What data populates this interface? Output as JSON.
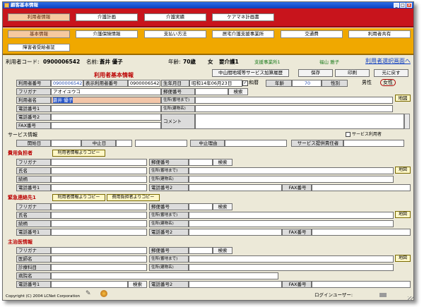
{
  "window": {
    "title": "顧客基本情報"
  },
  "tabs_row1": [
    "利用者情報",
    "介護計画",
    "介護実績",
    "ケアマネ計画書"
  ],
  "tabs_row2": [
    "基本情報",
    "介護保険情報",
    "支払い方法",
    "居宅介護支援事業所",
    "交通費",
    "利用者共有",
    "障害者受給者証"
  ],
  "header": {
    "user_code_label": "利用者コード:",
    "user_code": "0900006542",
    "name_label": "名前:",
    "name": "蒼井 優子",
    "age_label": "年齢:",
    "age": "70歳",
    "gender": "女",
    "care_level": "要介護1",
    "office": "支援事業所1",
    "staff": "福山 雅子",
    "switch_link": "利用者選択画面へ"
  },
  "basic": {
    "heading": "利用者基本情報",
    "btn_history": "中山間地域等サービス加算履歴",
    "btn_save": "保存",
    "btn_print": "印刷",
    "btn_back": "元に戻す",
    "lbl_user_no": "利用者番号",
    "user_no": "0900006542",
    "lbl_display_no": "表示利用者番号",
    "display_no": "0900006542",
    "lbl_birth": "生年月日",
    "birth": "昭和14年06月23日",
    "era_check": "和暦",
    "lbl_age": "年齢",
    "age_val": "70",
    "lbl_gender": "性別",
    "gender_male": "男性",
    "gender_female": "女性",
    "lbl_furigana": "フリガナ",
    "furigana": "アオイユウコ",
    "lbl_name": "利用者名",
    "name": "蒼井 優子",
    "lbl_tel1": "電話番号1",
    "lbl_tel2": "電話番号2",
    "lbl_fax": "FAX番号",
    "lbl_zip": "郵便番号",
    "btn_search": "検索",
    "lbl_addr1": "住所(番地まで)",
    "lbl_addr2": "住所(建物名)",
    "lbl_comment": "コメント",
    "btn_map": "地図"
  },
  "service": {
    "heading": "サービス情報",
    "service_user_check": "サービス利用者",
    "lbl_start": "開始日",
    "lbl_stop": "中止日",
    "lbl_reason": "中止理由",
    "lbl_responsible": "サービス提供責任者"
  },
  "payer": {
    "heading": "費用負担者",
    "btn_copy_user": "利用者情報よりコピー",
    "lbl_furigana": "フリガナ",
    "lbl_name": "氏名",
    "lbl_relation": "続柄",
    "lbl_tel1": "電話番号1",
    "lbl_zip": "郵便番号",
    "btn_search": "検索",
    "lbl_addr1": "住所(番地まで)",
    "lbl_addr2": "住所(建物名)",
    "lbl_tel2": "電話番号2",
    "lbl_fax": "FAX番号",
    "btn_map": "地図"
  },
  "emergency": {
    "heading": "緊急連絡先1",
    "btn_copy_user": "利用者情報よりコピー",
    "btn_copy_payer": "費用負担者よりコピー",
    "lbl_furigana": "フリガナ",
    "lbl_name": "氏名",
    "lbl_relation": "続柄",
    "lbl_tel1": "電話番号1",
    "lbl_zip": "郵便番号",
    "btn_search": "検索",
    "lbl_addr1": "住所(番地まで)",
    "lbl_addr2": "住所(建物名)",
    "lbl_tel2": "電話番号2",
    "lbl_fax": "FAX番号",
    "btn_map": "地図"
  },
  "doctor": {
    "heading": "主治医情報",
    "lbl_furigana": "フリガナ",
    "lbl_clinic": "医師名",
    "lbl_dept": "診療科目",
    "lbl_hospital": "病院名",
    "lbl_tel1": "電話番号1",
    "btn_search_tel": "検索",
    "lbl_zip": "郵便番号",
    "btn_search": "検索",
    "lbl_addr1": "住所(番地まで)",
    "lbl_addr2": "住所(建物名)",
    "lbl_tel2": "電話番号2",
    "lbl_fax": "FAX番号",
    "btn_map": "地図"
  },
  "footer": {
    "copyright": "Copyright (C) 2004 LCNet Corporation",
    "login_label": "ログインユーザー:"
  }
}
